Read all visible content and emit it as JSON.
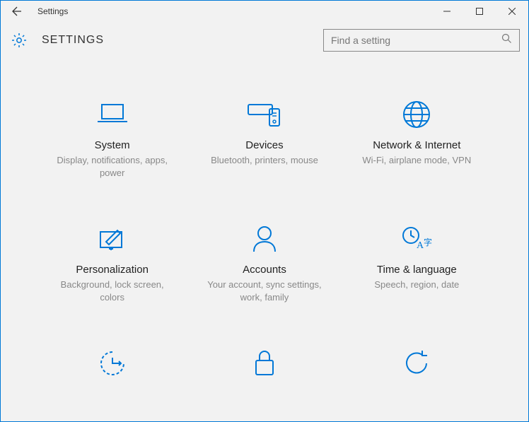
{
  "window": {
    "title": "Settings"
  },
  "header": {
    "page_title": "SETTINGS"
  },
  "search": {
    "placeholder": "Find a setting"
  },
  "tiles": [
    {
      "title": "System",
      "desc": "Display, notifications, apps, power",
      "icon": "laptop-icon"
    },
    {
      "title": "Devices",
      "desc": "Bluetooth, printers, mouse",
      "icon": "devices-icon"
    },
    {
      "title": "Network & Internet",
      "desc": "Wi-Fi, airplane mode, VPN",
      "icon": "globe-icon"
    },
    {
      "title": "Personalization",
      "desc": "Background, lock screen, colors",
      "icon": "personalization-icon"
    },
    {
      "title": "Accounts",
      "desc": "Your account, sync settings, work, family",
      "icon": "accounts-icon"
    },
    {
      "title": "Time & language",
      "desc": "Speech, region, date",
      "icon": "time-language-icon"
    },
    {
      "title": "",
      "desc": "",
      "icon": "ease-of-access-icon"
    },
    {
      "title": "",
      "desc": "",
      "icon": "privacy-icon"
    },
    {
      "title": "",
      "desc": "",
      "icon": "update-icon"
    }
  ]
}
